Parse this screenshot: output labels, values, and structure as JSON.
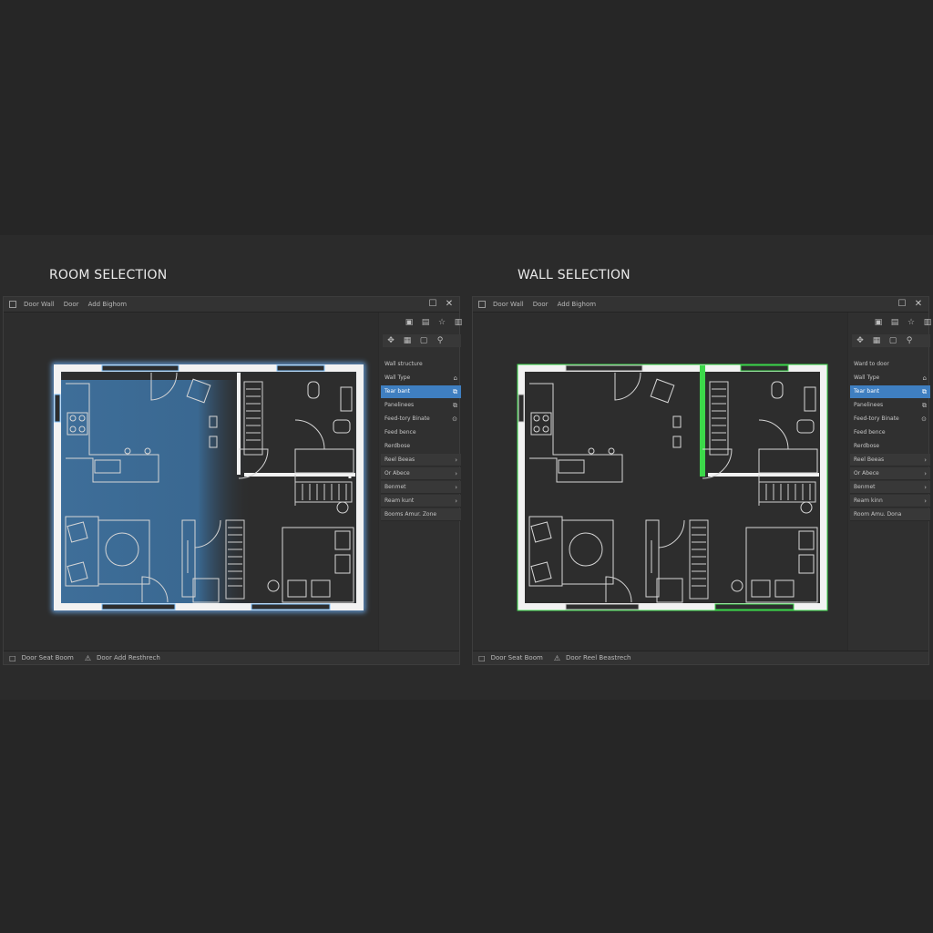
{
  "panels": [
    {
      "title": "ROOM SELECTION",
      "titlebar_items": [
        "Door Wall",
        "Door",
        "Add Bighom"
      ],
      "statusbar_items": [
        "Door Seat Boom",
        "Door Add Resthrech"
      ],
      "menu": [
        {
          "label": "Wall structure",
          "icon": "",
          "style": "plain"
        },
        {
          "label": "Wall Type",
          "icon": "⌂",
          "style": "plain"
        },
        {
          "label": "Tear bant",
          "icon": "⧉",
          "style": "selected"
        },
        {
          "label": "Panelinees",
          "icon": "⧉",
          "style": "plain"
        },
        {
          "label": "Feed-tory Binate",
          "icon": "⊙",
          "style": "plain"
        },
        {
          "label": "Feed bence",
          "icon": "",
          "style": "plain"
        },
        {
          "label": "Rerdbose",
          "icon": "",
          "style": "plain"
        },
        {
          "label": "Reel Beeas",
          "icon": "›",
          "style": "button"
        },
        {
          "label": "Or Abece",
          "icon": "›",
          "style": "button"
        },
        {
          "label": "Benmet",
          "icon": "›",
          "style": "button"
        },
        {
          "label": "Ream kunt",
          "icon": "›",
          "style": "button"
        },
        {
          "label": "Booms Amur. Zone",
          "icon": "",
          "style": "button"
        }
      ],
      "selection_color": "#3f7fc1"
    },
    {
      "title": "WALL SELECTION",
      "titlebar_items": [
        "Door Wall",
        "Door",
        "Add Bighom"
      ],
      "statusbar_items": [
        "Door Seat Boom",
        "Door Reel Beastrech"
      ],
      "menu": [
        {
          "label": "Ward to door",
          "icon": "",
          "style": "plain"
        },
        {
          "label": "Wall Type",
          "icon": "⌂",
          "style": "plain"
        },
        {
          "label": "Tear bant",
          "icon": "⧉",
          "style": "selected"
        },
        {
          "label": "Panelinees",
          "icon": "⧉",
          "style": "plain"
        },
        {
          "label": "Feed-tory Binate",
          "icon": "⊙",
          "style": "plain"
        },
        {
          "label": "Feed bence",
          "icon": "",
          "style": "plain"
        },
        {
          "label": "Rerdbose",
          "icon": "",
          "style": "plain"
        },
        {
          "label": "Reel Beeas",
          "icon": "›",
          "style": "button"
        },
        {
          "label": "Or Abece",
          "icon": "›",
          "style": "button"
        },
        {
          "label": "Benmet",
          "icon": "›",
          "style": "button"
        },
        {
          "label": "Ream kinn",
          "icon": "›",
          "style": "button"
        },
        {
          "label": "Room Amu. Dona",
          "icon": "",
          "style": "button"
        }
      ],
      "selection_color": "#3cd84a"
    }
  ],
  "icons": {
    "window_close": "✕",
    "window_maximize": "☐",
    "warning": "⚠",
    "toolbar_top": [
      "▣",
      "▤",
      "☆",
      "▥"
    ],
    "toolbar_second": [
      "✥",
      "▦",
      "▢",
      "⚲"
    ]
  }
}
